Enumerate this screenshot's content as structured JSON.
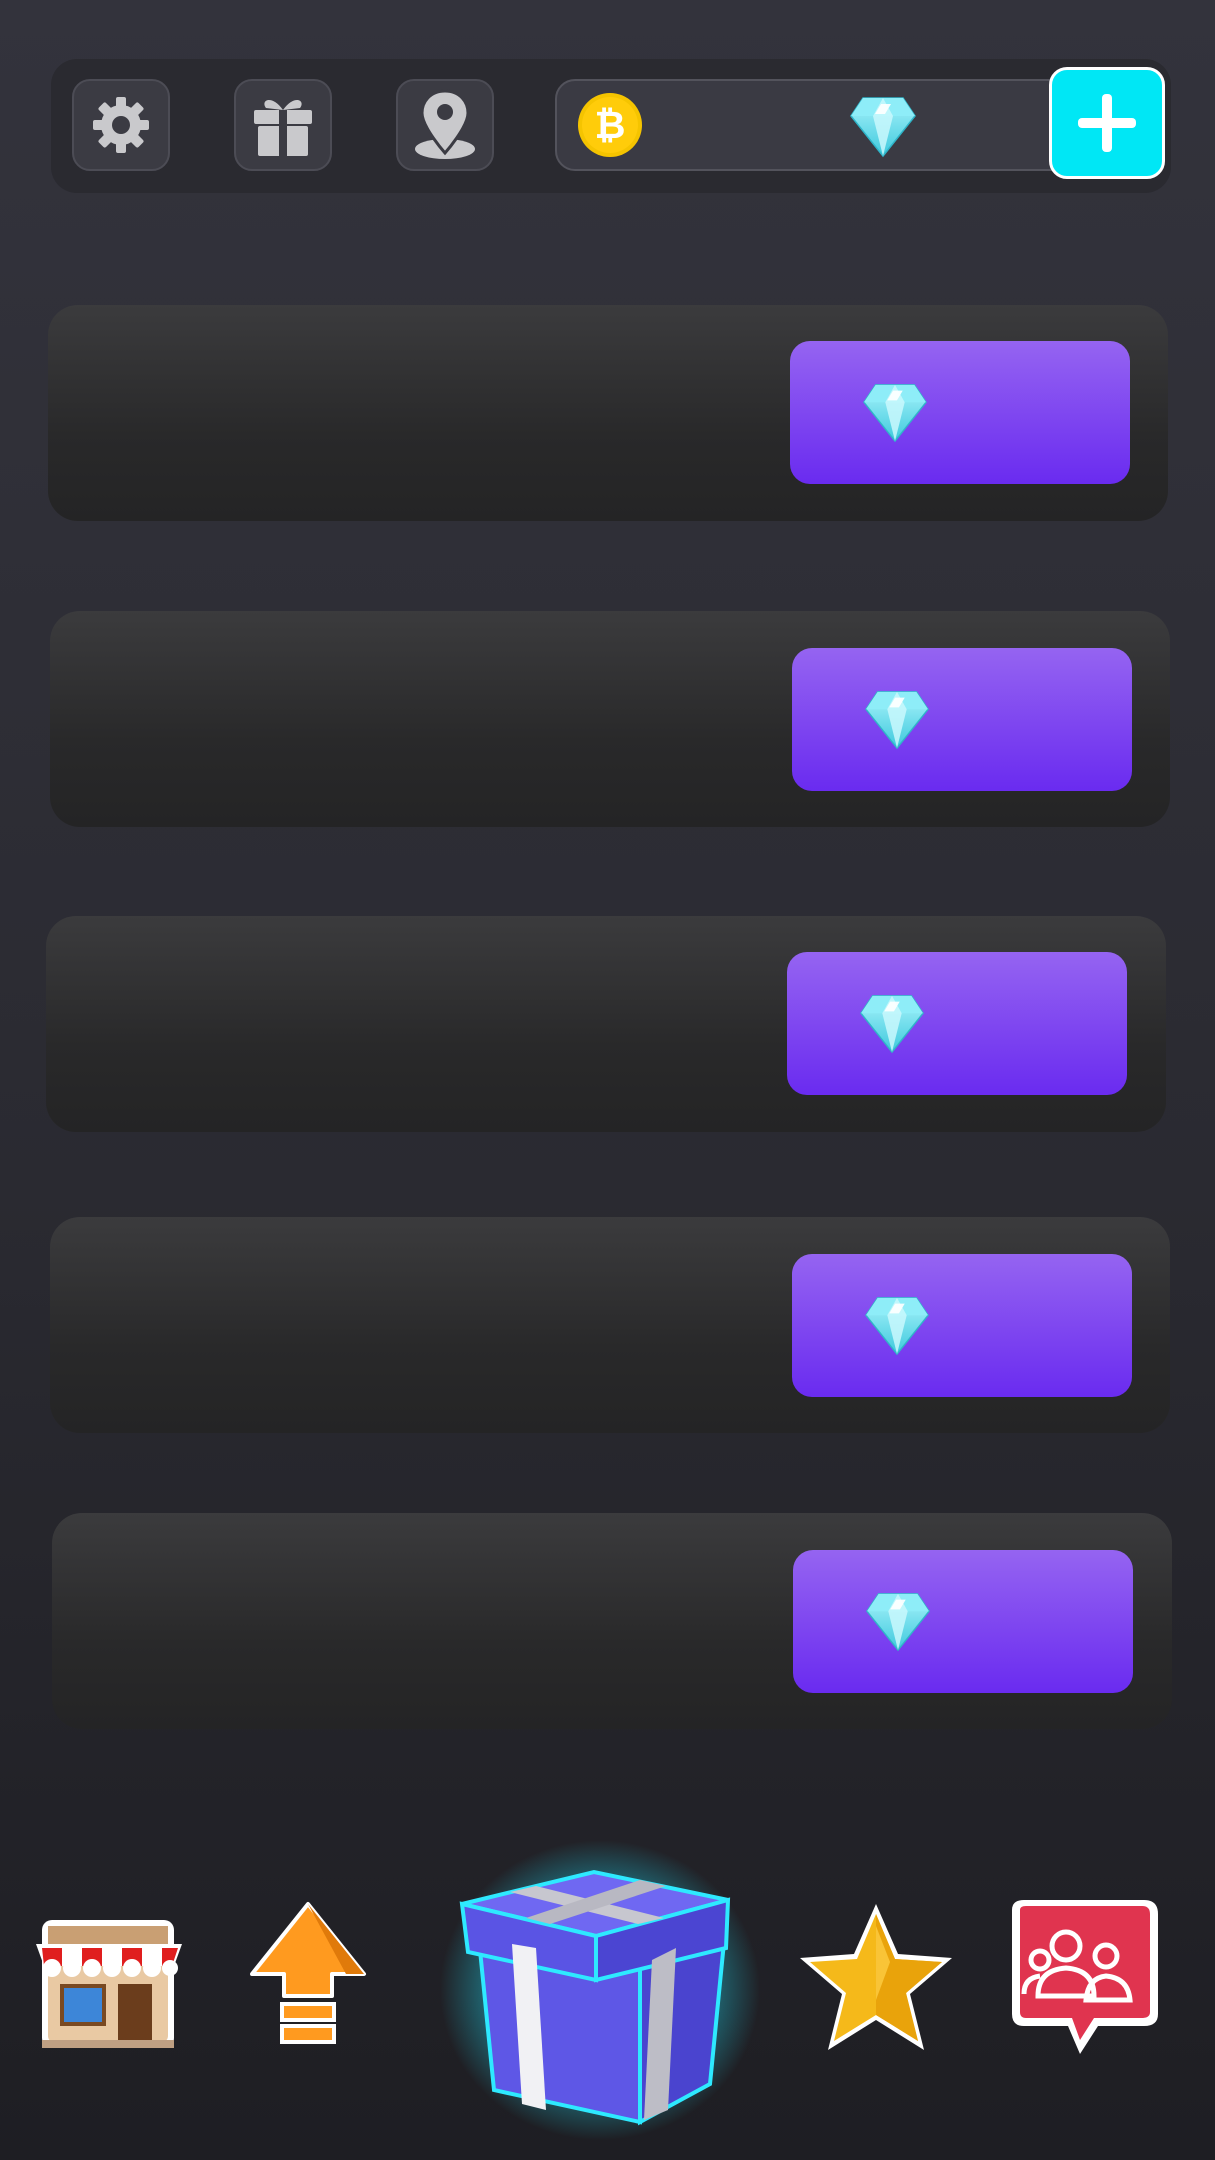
{
  "topbar": {
    "buttons": [
      {
        "name": "settings",
        "icon": "gear-icon"
      },
      {
        "name": "gift",
        "icon": "gift-icon"
      },
      {
        "name": "location",
        "icon": "location-pin-icon"
      }
    ],
    "currency": {
      "coin_icon": "bitcoin-coin-icon",
      "coin_value": "",
      "gem_icon": "diamond-gem-icon",
      "gem_value": ""
    },
    "add_button_icon": "plus-icon"
  },
  "offers": [
    {
      "title": "",
      "price": "",
      "icon": "diamond-gem-icon"
    },
    {
      "title": "",
      "price": "",
      "icon": "diamond-gem-icon"
    },
    {
      "title": "",
      "price": "",
      "icon": "diamond-gem-icon"
    },
    {
      "title": "",
      "price": "",
      "icon": "diamond-gem-icon"
    },
    {
      "title": "",
      "price": "",
      "icon": "diamond-gem-icon"
    }
  ],
  "bottom_nav": [
    {
      "name": "shop",
      "icon": "shop-icon"
    },
    {
      "name": "upgrade",
      "icon": "upgrade-arrow-icon"
    },
    {
      "name": "gift-box",
      "icon": "gift-box-icon",
      "active": true
    },
    {
      "name": "favorites",
      "icon": "star-icon"
    },
    {
      "name": "social",
      "icon": "friends-chat-icon"
    }
  ],
  "colors": {
    "background": "#2e2e35",
    "buy_button": "#7c3ff2",
    "plus_button": "#00e7f5",
    "gem": "#6fe4f2",
    "coin": "#f5c400"
  }
}
